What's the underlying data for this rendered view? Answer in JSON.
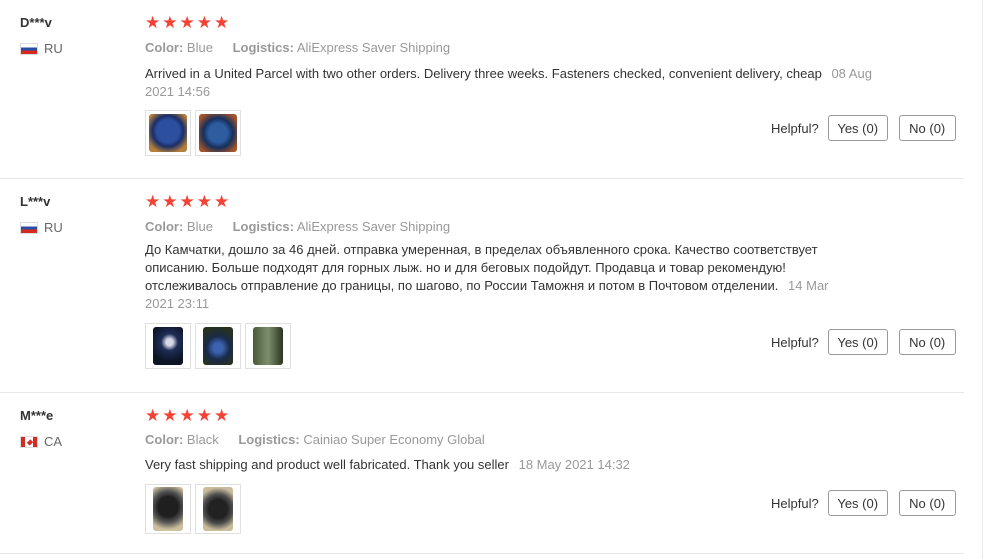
{
  "helpful_label": "Helpful?",
  "reviews": [
    {
      "user": "D***v",
      "country": "RU",
      "flag": "ru-flag",
      "stars": 5,
      "color_label": "Color:",
      "color_value": "Blue",
      "logistics_label": "Logistics:",
      "logistics_value": "AliExpress Saver Shipping",
      "text": "Arrived in a United Parcel with two other orders. Delivery three weeks. Fasteners checked, convenient delivery, cheap",
      "date": "08 Aug 2021 14:56",
      "photos": [
        "review-photo",
        "review-photo"
      ],
      "yes": "Yes (0)",
      "no": "No (0)"
    },
    {
      "user": "L***v",
      "country": "RU",
      "flag": "ru-flag",
      "stars": 5,
      "color_label": "Color:",
      "color_value": "Blue",
      "logistics_label": "Logistics:",
      "logistics_value": "AliExpress Saver Shipping",
      "text": "До Камчатки, дошло за 46 дней. отправка умеренная, в пределах объявленного срока. Качество соответствует описанию. Больше подходят для горных лыж. но и для беговых подойдут. Продавца и товар рекомендую! отслеживалось отправление до границы, по шагово, по России Таможня и потом в Почтовом отделении.",
      "date": "14 Mar 2021 23:11",
      "photos": [
        "review-photo",
        "review-photo",
        "review-photo"
      ],
      "yes": "Yes (0)",
      "no": "No (0)"
    },
    {
      "user": "M***e",
      "country": "CA",
      "flag": "ca-flag",
      "stars": 5,
      "color_label": "Color:",
      "color_value": "Black",
      "logistics_label": "Logistics:",
      "logistics_value": "Cainiao Super Economy Global",
      "text": "Very fast shipping and product well fabricated. Thank you seller",
      "date": "18 May 2021 14:32",
      "photos": [
        "review-photo",
        "review-photo"
      ],
      "yes": "Yes (0)",
      "no": "No (0)"
    }
  ],
  "colors": {
    "star": "#f44336",
    "muted": "#999999",
    "text": "#333333",
    "divider": "#e6e6e6"
  }
}
